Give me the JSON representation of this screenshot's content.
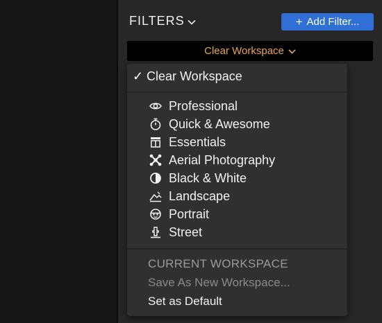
{
  "header": {
    "title": "FILTERS",
    "add_filter_label": "Add Filter..."
  },
  "workspace_select": {
    "label": "Clear Workspace",
    "accent_color": "#e9a54a"
  },
  "dropdown": {
    "selected_item": "Clear Workspace",
    "workspaces": [
      {
        "label": "Professional",
        "icon": "eye-icon"
      },
      {
        "label": "Quick & Awesome",
        "icon": "stopwatch-icon"
      },
      {
        "label": "Essentials",
        "icon": "columns-icon"
      },
      {
        "label": "Aerial Photography",
        "icon": "drone-icon"
      },
      {
        "label": "Black & White",
        "icon": "half-circle-icon"
      },
      {
        "label": "Landscape",
        "icon": "mountain-icon"
      },
      {
        "label": "Portrait",
        "icon": "face-icon"
      },
      {
        "label": "Street",
        "icon": "hydrant-icon"
      }
    ],
    "section_header": "CURRENT WORKSPACE",
    "save_as_new": "Save As New Workspace...",
    "set_default": "Set as Default"
  },
  "colors": {
    "button_blue": "#2f6fd6",
    "panel_bg": "#272727",
    "menu_bg": "#303030"
  }
}
